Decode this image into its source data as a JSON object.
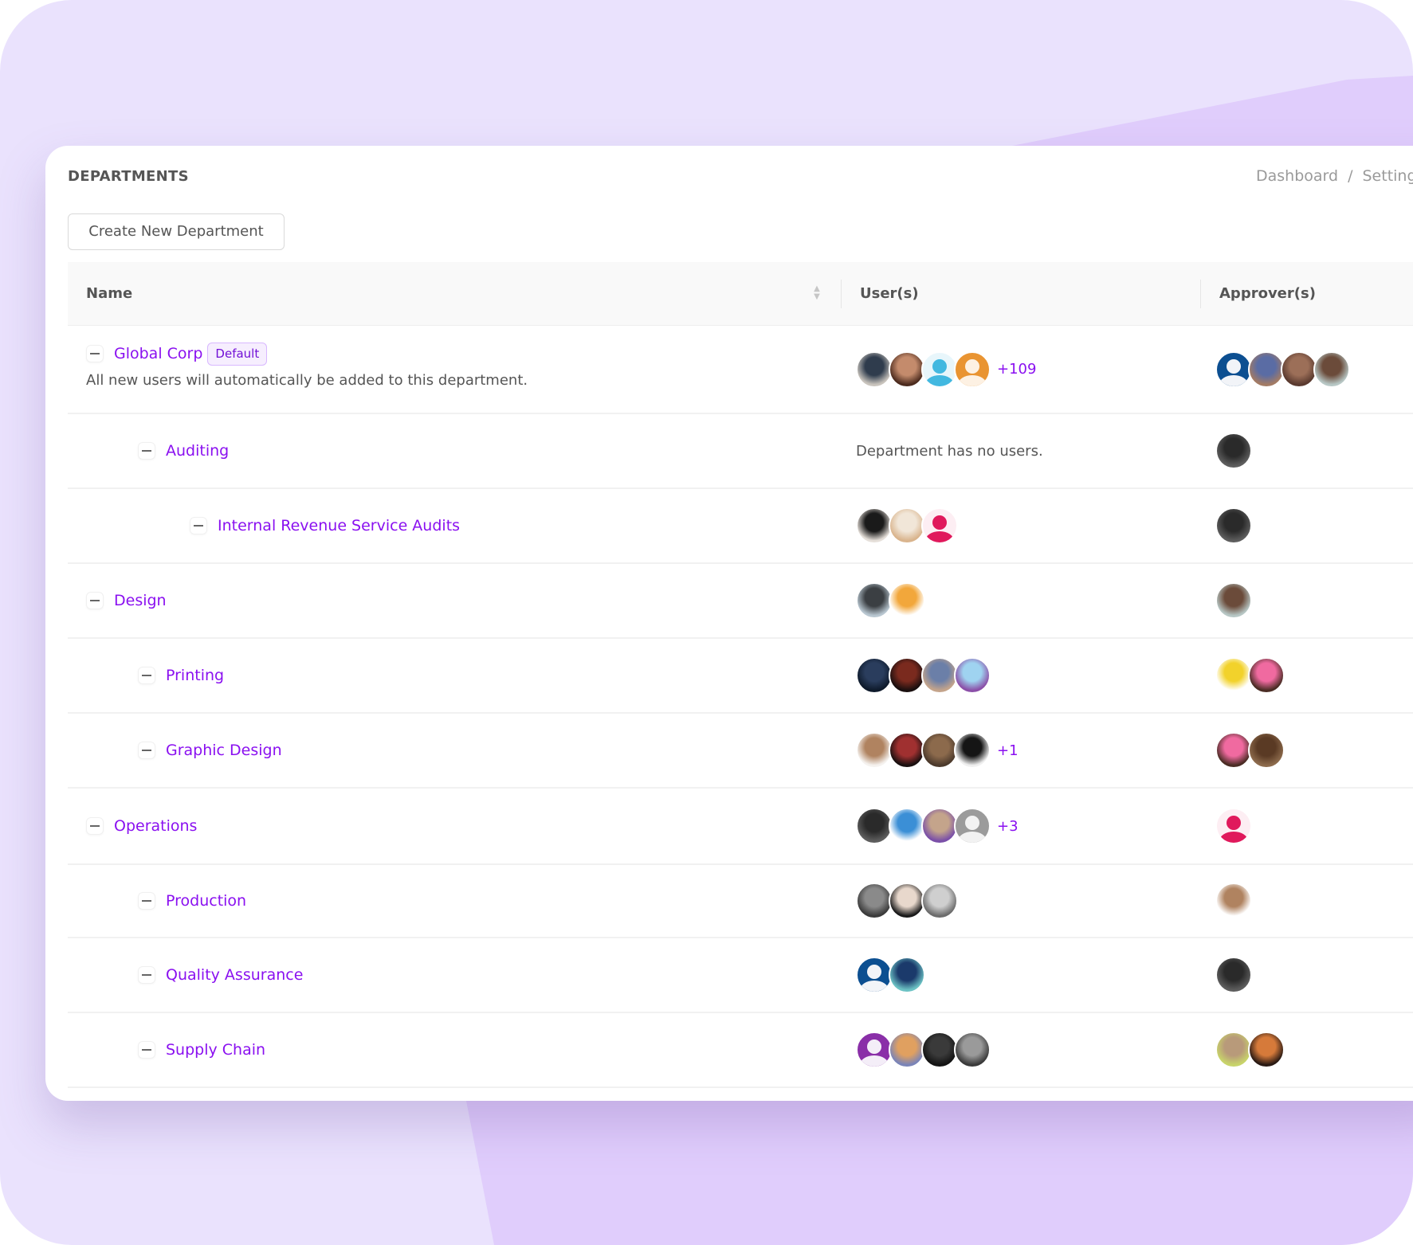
{
  "header": {
    "title": "DEPARTMENTS",
    "breadcrumb": [
      "Dashboard",
      "Settings"
    ],
    "breadcrumb_separator": "/"
  },
  "toolbar": {
    "create_label": "Create New Department"
  },
  "table": {
    "columns": {
      "name": "Name",
      "users": "User(s)",
      "approvers": "Approver(s)"
    },
    "sortable_column": "Name",
    "rows": [
      {
        "name": "Global Corp",
        "level": 0,
        "badge": "Default",
        "description": "All new users will automatically be added to this department.",
        "users": [
          {
            "type": "photo",
            "colors": [
              "#c9c4bd",
              "#2f3c4d"
            ]
          },
          {
            "type": "photo",
            "colors": [
              "#4c2b1e",
              "#c48b6c"
            ]
          },
          {
            "type": "generic",
            "bg": "#e8f6fb",
            "fg": "#42b8e0"
          },
          {
            "type": "generic",
            "bg": "#e99432",
            "fg": "#fdf1e3"
          }
        ],
        "users_more": "+109",
        "approvers": [
          {
            "type": "generic",
            "bg": "#0c4f91",
            "fg": "#f2f4f8"
          },
          {
            "type": "photo",
            "colors": [
              "#a37b64",
              "#5a6ca4"
            ]
          },
          {
            "type": "photo",
            "colors": [
              "#5a3a2f",
              "#9c6f58"
            ]
          },
          {
            "type": "photo",
            "colors": [
              "#b7c7c5",
              "#6b4b3a"
            ]
          }
        ]
      },
      {
        "name": "Auditing",
        "level": 1,
        "users_empty": "Department has no users.",
        "users": [],
        "approvers": [
          {
            "type": "photo",
            "colors": [
              "#5d5d5d",
              "#2a2a2a"
            ]
          }
        ]
      },
      {
        "name": "Internal Revenue Service Audits",
        "level": 2,
        "users": [
          {
            "type": "photo",
            "colors": [
              "#e6e0da",
              "#1a1a1a"
            ]
          },
          {
            "type": "photo",
            "colors": [
              "#d9b48d",
              "#f1e6d8"
            ]
          },
          {
            "type": "generic",
            "bg": "#fdeef3",
            "fg": "#e0195c"
          }
        ],
        "approvers": [
          {
            "type": "photo",
            "colors": [
              "#5d5d5d",
              "#2a2a2a"
            ]
          }
        ]
      },
      {
        "name": "Design",
        "level": 0,
        "users": [
          {
            "type": "photo",
            "colors": [
              "#b9c7d1",
              "#3b3f43"
            ]
          },
          {
            "type": "photo",
            "colors": [
              "#ffffff",
              "#f2a73b"
            ]
          }
        ],
        "approvers": [
          {
            "type": "photo",
            "colors": [
              "#b7c7c5",
              "#6b4b3a"
            ]
          }
        ]
      },
      {
        "name": "Printing",
        "level": 1,
        "users": [
          {
            "type": "photo",
            "colors": [
              "#0e1a2b",
              "#2a3d5d"
            ]
          },
          {
            "type": "photo",
            "colors": [
              "#1a0f0f",
              "#7a2a1e"
            ]
          },
          {
            "type": "photo",
            "colors": [
              "#c4a48b",
              "#6b7fa8"
            ]
          },
          {
            "type": "photo",
            "colors": [
              "#8b4fa8",
              "#9fd3f0"
            ]
          }
        ],
        "approvers": [
          {
            "type": "photo",
            "colors": [
              "#ffffff",
              "#f2d22b"
            ]
          },
          {
            "type": "photo",
            "colors": [
              "#4a2c24",
              "#f06aa0"
            ]
          }
        ]
      },
      {
        "name": "Graphic Design",
        "level": 1,
        "users": [
          {
            "type": "photo",
            "colors": [
              "#f5f2ef",
              "#b08360"
            ]
          },
          {
            "type": "photo",
            "colors": [
              "#1a1010",
              "#a03030"
            ]
          },
          {
            "type": "photo",
            "colors": [
              "#4c3a2c",
              "#8c6a4c"
            ]
          },
          {
            "type": "photo",
            "colors": [
              "#f0f0f0",
              "#151515"
            ]
          }
        ],
        "users_more": "+1",
        "approvers": [
          {
            "type": "photo",
            "colors": [
              "#4a2c24",
              "#f06aa0"
            ]
          },
          {
            "type": "photo",
            "colors": [
              "#8c6a4c",
              "#5a3a24"
            ]
          }
        ]
      },
      {
        "name": "Operations",
        "level": 0,
        "users": [
          {
            "type": "photo",
            "colors": [
              "#5d5d5d",
              "#2a2a2a"
            ]
          },
          {
            "type": "photo",
            "colors": [
              "#ffffff",
              "#3b8fd6"
            ]
          },
          {
            "type": "photo",
            "colors": [
              "#7a4fa8",
              "#c4a48b"
            ]
          },
          {
            "type": "generic",
            "bg": "#9b9b9b",
            "fg": "#f2f2f2"
          }
        ],
        "users_more": "+3",
        "approvers": [
          {
            "type": "generic",
            "bg": "#fdeef3",
            "fg": "#e0195c"
          }
        ]
      },
      {
        "name": "Production",
        "level": 1,
        "users": [
          {
            "type": "photo",
            "colors": [
              "#3b3b3b",
              "#8a8a8a"
            ]
          },
          {
            "type": "photo",
            "colors": [
              "#1a1a1a",
              "#e8d8cc"
            ]
          },
          {
            "type": "photo",
            "colors": [
              "#6c6c6c",
              "#cfcfcf"
            ]
          }
        ],
        "approvers": [
          {
            "type": "photo",
            "colors": [
              "#ffffff",
              "#b08360"
            ]
          }
        ]
      },
      {
        "name": "Quality Assurance",
        "level": 1,
        "users": [
          {
            "type": "generic",
            "bg": "#0c4f91",
            "fg": "#f2f4f8"
          },
          {
            "type": "photo",
            "colors": [
              "#6cc2c4",
              "#1b3a6b"
            ]
          }
        ],
        "approvers": [
          {
            "type": "photo",
            "colors": [
              "#5d5d5d",
              "#2a2a2a"
            ]
          }
        ]
      },
      {
        "name": "Supply Chain",
        "level": 1,
        "users": [
          {
            "type": "generic",
            "bg": "#8a2fa8",
            "fg": "#f4eef8"
          },
          {
            "type": "photo",
            "colors": [
              "#7a84b8",
              "#e0a060"
            ]
          },
          {
            "type": "photo",
            "colors": [
              "#141414",
              "#3a3a3a"
            ]
          },
          {
            "type": "photo",
            "colors": [
              "#3a3a3a",
              "#9a9a9a"
            ]
          }
        ],
        "approvers": [
          {
            "type": "photo",
            "colors": [
              "#c8d46a",
              "#b89a7a"
            ]
          },
          {
            "type": "photo",
            "colors": [
              "#2a1a14",
              "#d67a3a"
            ]
          }
        ]
      }
    ]
  },
  "colors": {
    "accent": "#8a10f0",
    "badge_bg": "#f6eefe",
    "badge_border": "#d8b8ff",
    "background": "#eae2fd",
    "background_accent": "#e0cdfc"
  }
}
